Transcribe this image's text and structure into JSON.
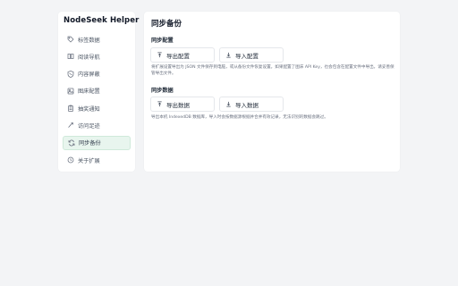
{
  "sidebar": {
    "app_title": "NodeSeek Helper",
    "items": [
      {
        "label": "标签数据",
        "icon": "tag-icon"
      },
      {
        "label": "阅读导航",
        "icon": "book-icon"
      },
      {
        "label": "内容屏蔽",
        "icon": "shield-icon"
      },
      {
        "label": "图床配置",
        "icon": "image-icon"
      },
      {
        "label": "抽奖通知",
        "icon": "clipboard-icon"
      },
      {
        "label": "访问足迹",
        "icon": "footprint-icon"
      },
      {
        "label": "同步备份",
        "icon": "sync-icon",
        "active": true
      },
      {
        "label": "关于扩展",
        "icon": "clock-icon"
      }
    ]
  },
  "main": {
    "title": "同步备份",
    "config_section": {
      "title": "同步配置",
      "export_label": "导出配置",
      "import_label": "导入配置",
      "description": "将扩展设置导出为 JSON 文件保存到电脑，或从备份文件恢复设置。如果配置了图床 API Key，也会包含在配置文件中导出，请妥善保管导出文件。"
    },
    "data_section": {
      "title": "同步数据",
      "export_label": "导出数据",
      "import_label": "导入数据",
      "description": "导出本机 IndexedDB 数据库，导入时会按数据源根据并合并有效记录，无法识别的数据会跳过。"
    }
  },
  "colors": {
    "accent_bg": "#e8f5ee",
    "accent_border": "#cfe9da",
    "page_bg": "#f3f4f6"
  }
}
